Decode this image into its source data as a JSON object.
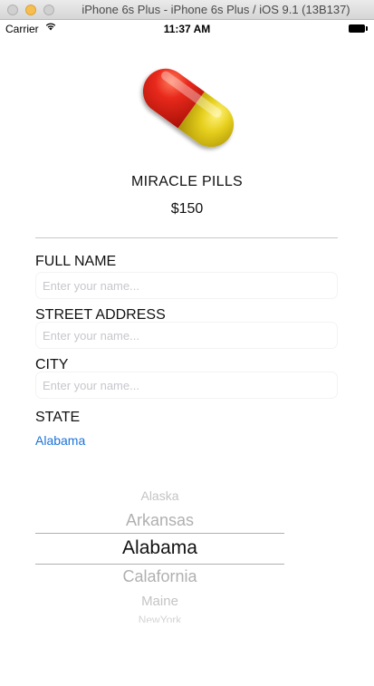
{
  "window": {
    "title": "iPhone 6s Plus - iPhone 6s Plus / iOS 9.1 (13B137)"
  },
  "status_bar": {
    "carrier": "Carrier",
    "time": "11:37 AM",
    "wifi_icon": "wifi-icon",
    "battery_icon": "battery-icon"
  },
  "product": {
    "image_icon": "pill-icon",
    "name": "MIRACLE PILLS",
    "price": "$150",
    "colors": {
      "capsule_red": "#e8291c",
      "capsule_yellow": "#e6cf1c"
    }
  },
  "form": {
    "full_name": {
      "label": "FULL NAME",
      "placeholder": "Enter your name...",
      "value": ""
    },
    "street_address": {
      "label": "STREET ADDRESS",
      "placeholder": "Enter your name...",
      "value": ""
    },
    "city": {
      "label": "CITY",
      "placeholder": "Enter your name...",
      "value": ""
    },
    "state": {
      "label": "STATE",
      "value": "Alabama"
    }
  },
  "picker": {
    "options": [
      "Alaska",
      "Arkansas",
      "Alabama",
      "Calafornia",
      "Maine",
      "NewYork"
    ],
    "selected": "Alabama"
  },
  "colors": {
    "accent": "#1a73d9",
    "text": "#111111",
    "placeholder": "#c7c7cd"
  }
}
